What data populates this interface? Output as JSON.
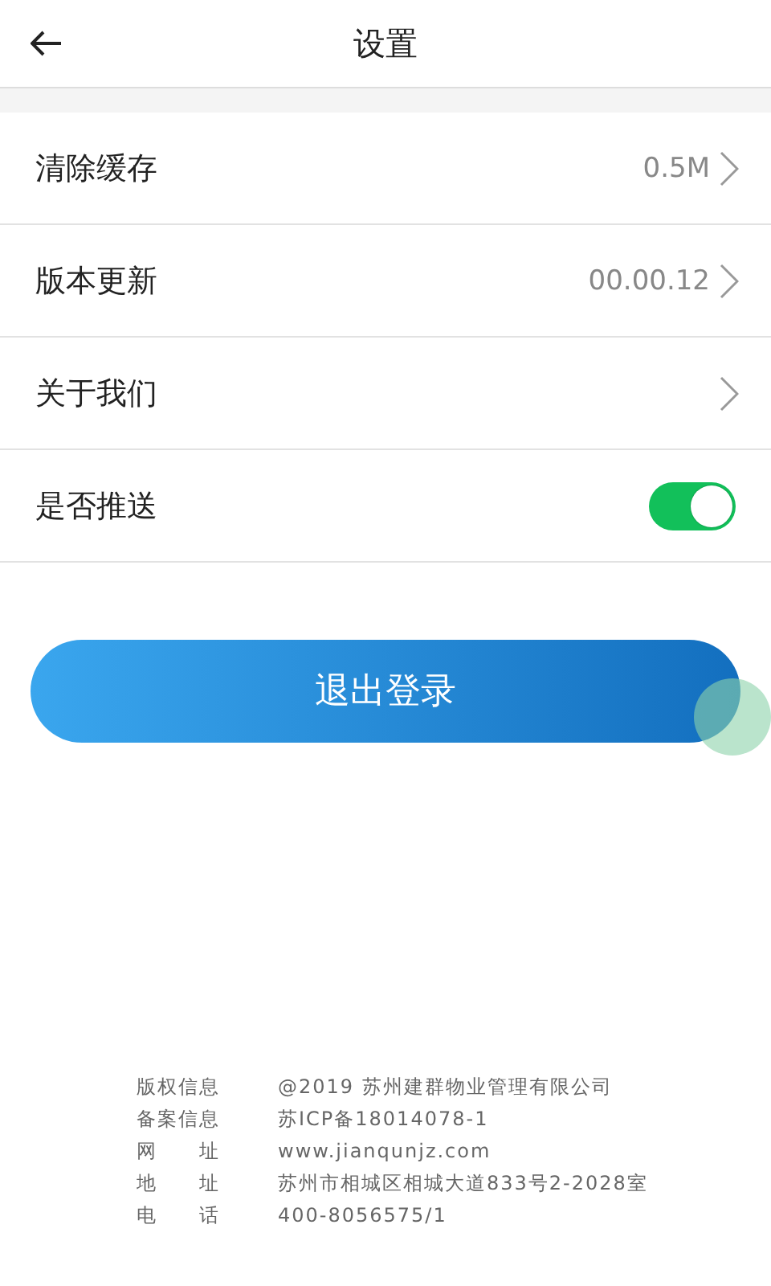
{
  "header": {
    "title": "设置"
  },
  "settings": [
    {
      "kind": "link",
      "label": "清除缓存",
      "value": "0.5M"
    },
    {
      "kind": "link",
      "label": "版本更新",
      "value": "00.00.12"
    },
    {
      "kind": "link",
      "label": "关于我们"
    },
    {
      "kind": "switch",
      "label": "是否推送",
      "on": true
    }
  ],
  "logout_button": "退出登录",
  "footer": [
    {
      "label": "版权信息",
      "value": "@2019 苏州建群物业管理有限公司"
    },
    {
      "label": "备案信息",
      "value": "苏ICP备18014078-1"
    },
    {
      "label": "网　　址",
      "value": "www.jianqunjz.com"
    },
    {
      "label": "地　　址",
      "value": "苏州市相城区相城大道833号2-2028室"
    },
    {
      "label": "电　　话",
      "value": "400-8056575/1"
    }
  ]
}
